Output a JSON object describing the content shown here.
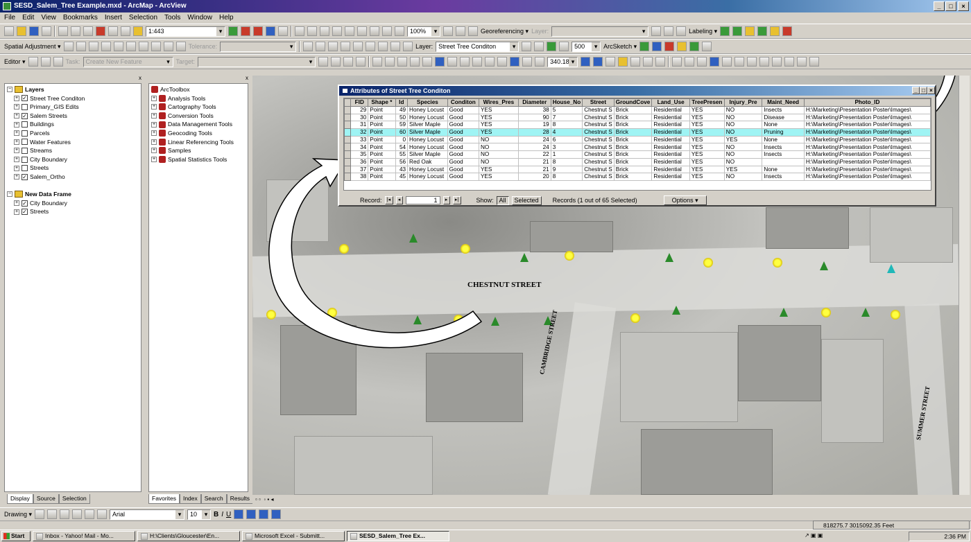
{
  "window": {
    "title": "SESD_Salem_Tree Example.mxd - ArcMap - ArcView",
    "min": "_",
    "max": "□",
    "close": "×"
  },
  "menu": [
    "File",
    "Edit",
    "View",
    "Bookmarks",
    "Insert",
    "Selection",
    "Tools",
    "Window",
    "Help"
  ],
  "toolbar1": {
    "scale": "1:443",
    "zoom_pct": "100%",
    "georef": "Georeferencing ▾",
    "layer_label": "Layer:",
    "labeling": "Labeling ▾"
  },
  "toolbar2": {
    "spatial_adjustment": "Spatial Adjustment ▾",
    "tolerance": "Tolerance:",
    "layer_label": "Layer:",
    "layer_value": "Street Tree Conditon",
    "buffer": "500",
    "arcsketch": "ArcSketch ▾"
  },
  "toolbar3": {
    "editor": "Editor ▾",
    "task_label": "Task:",
    "task_value": "Create New Feature",
    "target_label": "Target:",
    "scale_box": "340.18"
  },
  "toc": {
    "root": "Layers",
    "layers": [
      {
        "name": "Street Tree Conditon",
        "checked": "✓"
      },
      {
        "name": "Primary_GIS Edits",
        "checked": ""
      },
      {
        "name": "Salem Streets",
        "checked": "✓"
      },
      {
        "name": "Buildings",
        "checked": ""
      },
      {
        "name": "Parcels",
        "checked": ""
      },
      {
        "name": "Water Features",
        "checked": ""
      },
      {
        "name": "Streams",
        "checked": ""
      },
      {
        "name": "City Boundary",
        "checked": ""
      },
      {
        "name": "Streets",
        "checked": ""
      },
      {
        "name": "Salem_Ortho",
        "checked": "✓"
      }
    ],
    "frame2": "New Data Frame",
    "frame2_layers": [
      {
        "name": "City Boundary",
        "checked": "✓"
      },
      {
        "name": "Streets",
        "checked": "✓"
      }
    ],
    "tabs": [
      "Display",
      "Source",
      "Selection"
    ]
  },
  "toolbox": {
    "root": "ArcToolbox",
    "items": [
      "Analysis Tools",
      "Cartography Tools",
      "Conversion Tools",
      "Data Management Tools",
      "Geocoding Tools",
      "Linear Referencing Tools",
      "Samples",
      "Spatial Statistics Tools"
    ],
    "tabs": [
      "Favorites",
      "Index",
      "Search",
      "Results"
    ]
  },
  "attr": {
    "title": "Attributes of Street Tree Conditon",
    "columns": [
      "FID",
      "Shape *",
      "Id",
      "Species",
      "Conditon",
      "Wires_Pres",
      "Diameter",
      "House_No",
      "Street",
      "GroundCove",
      "Land_Use",
      "TreePresen",
      "Injury_Pre",
      "Maint_Need",
      "Photo_ID"
    ],
    "rows": [
      [
        "29",
        "Point",
        "49",
        "Honey Locust",
        "Good",
        "YES",
        "38",
        "5",
        "Chestnut S",
        "Brick",
        "Residential",
        "YES",
        "NO",
        "Insects",
        "H:\\Marketing\\Presentation Poster\\Images\\"
      ],
      [
        "30",
        "Point",
        "50",
        "Honey Locust",
        "Good",
        "YES",
        "90",
        "7",
        "Chestnut S",
        "Brick",
        "Residential",
        "YES",
        "NO",
        "Disease",
        "H:\\Marketing\\Presentation Poster\\Images\\"
      ],
      [
        "31",
        "Point",
        "59",
        "Silver Maple",
        "Good",
        "YES",
        "19",
        "8",
        "Chestnut S",
        "Brick",
        "Residential",
        "YES",
        "NO",
        "None",
        "H:\\Marketing\\Presentation Poster\\Images\\"
      ],
      [
        "32",
        "Point",
        "60",
        "Silver Maple",
        "Good",
        "YES",
        "28",
        "4",
        "Chestnut S",
        "Brick",
        "Residential",
        "YES",
        "NO",
        "Pruning",
        "H:\\Marketing\\Presentation Poster\\Images\\"
      ],
      [
        "33",
        "Point",
        "0",
        "Honey Locust",
        "Good",
        "NO",
        "24",
        "6",
        "Chestnut S",
        "Brick",
        "Residential",
        "YES",
        "YES",
        "None",
        "H:\\Marketing\\Presentation Poster\\Images\\"
      ],
      [
        "34",
        "Point",
        "54",
        "Honey Locust",
        "Good",
        "NO",
        "24",
        "3",
        "Chestnut S",
        "Brick",
        "Residential",
        "YES",
        "NO",
        "Insects",
        "H:\\Marketing\\Presentation Poster\\Images\\"
      ],
      [
        "35",
        "Point",
        "55",
        "Silver Maple",
        "Good",
        "NO",
        "22",
        "1",
        "Chestnut S",
        "Brick",
        "Residential",
        "YES",
        "NO",
        "Insects",
        "H:\\Marketing\\Presentation Poster\\Images\\"
      ],
      [
        "36",
        "Point",
        "56",
        "Red Oak",
        "Good",
        "NO",
        "21",
        "8",
        "Chestnut S",
        "Brick",
        "Residential",
        "YES",
        "NO",
        "",
        "H:\\Marketing\\Presentation Poster\\Images\\"
      ],
      [
        "37",
        "Point",
        "43",
        "Honey Locust",
        "Good",
        "YES",
        "21",
        "9",
        "Chestnut S",
        "Brick",
        "Residential",
        "YES",
        "YES",
        "None",
        "H:\\Marketing\\Presentation Poster\\Images\\"
      ],
      [
        "38",
        "Point",
        "45",
        "Honey Locust",
        "Good",
        "YES",
        "20",
        "8",
        "Chestnut S",
        "Brick",
        "Residential",
        "YES",
        "NO",
        "Insects",
        "H:\\Marketing\\Presentation Poster\\Images\\"
      ]
    ],
    "selected_index": 3,
    "record_label": "Record:",
    "record_value": "1",
    "show_label": "Show:",
    "show_all": "All",
    "show_selected": "Selected",
    "status": "Records (1 out of 65 Selected)",
    "options": "Options ▾"
  },
  "map": {
    "labels": {
      "chestnut": "CHESTNUT STREET",
      "cambridge": "CAMBRIDGE STREET",
      "summer": "SUMMER STREET"
    }
  },
  "drawing_bar": {
    "drawing": "Drawing ▾",
    "font": "Arial",
    "size": "10",
    "bold": "B",
    "italic": "I",
    "underline": "U"
  },
  "status": {
    "coords": "818275.7  3015092.35 Feet"
  },
  "taskbar": {
    "start": "Start",
    "tasks": [
      "Inbox - Yahoo! Mail - Mo...",
      "H:\\Clients\\Gloucester\\En...",
      "Microsoft Excel - Submitt...",
      "SESD_Salem_Tree Ex..."
    ],
    "clock": "2:36 PM"
  }
}
